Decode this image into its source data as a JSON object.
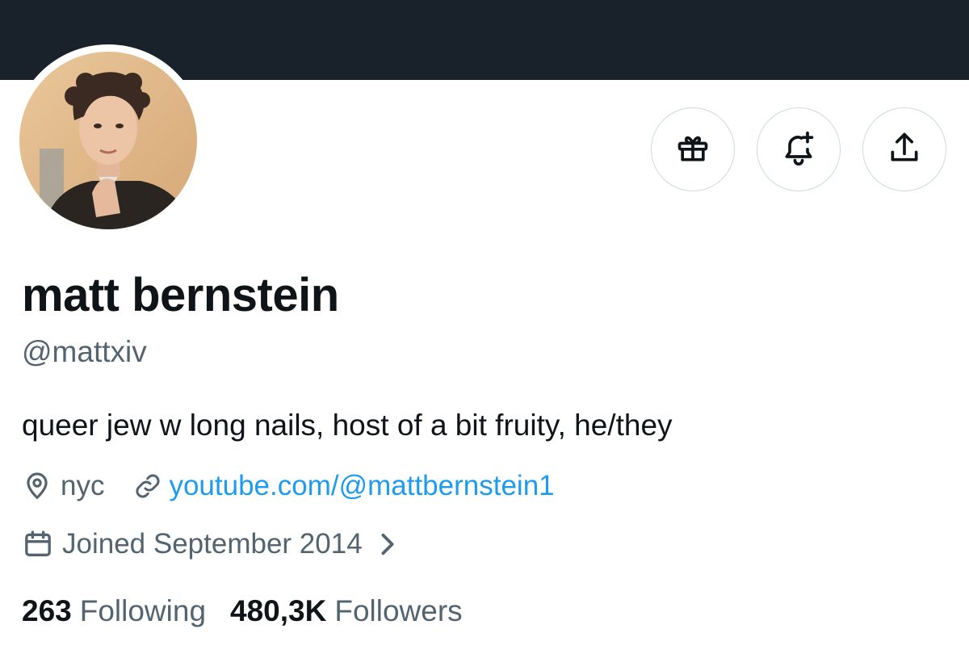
{
  "profile": {
    "display_name": "matt bernstein",
    "handle": "@mattxiv",
    "bio": "queer jew w long nails, host of a bit fruity, he/they",
    "location": "nyc",
    "website": "youtube.com/@mattbernstein1",
    "joined": "Joined September 2014"
  },
  "stats": {
    "following_count": "263",
    "following_label": "Following",
    "followers_count": "480,3K",
    "followers_label": "Followers"
  },
  "actions": [
    {
      "name": "gift",
      "icon": "gift-icon"
    },
    {
      "name": "notifications",
      "icon": "bell-plus-icon"
    },
    {
      "name": "share",
      "icon": "share-icon"
    }
  ],
  "colors": {
    "banner": "#19212b",
    "text_primary": "#0f1419",
    "text_secondary": "#536471",
    "link": "#1d9bf0",
    "button_border": "#cfd9de"
  },
  "icons": {
    "location": "location-pin-icon",
    "link": "link-icon",
    "calendar": "calendar-icon",
    "chevron": "chevron-right-icon"
  }
}
